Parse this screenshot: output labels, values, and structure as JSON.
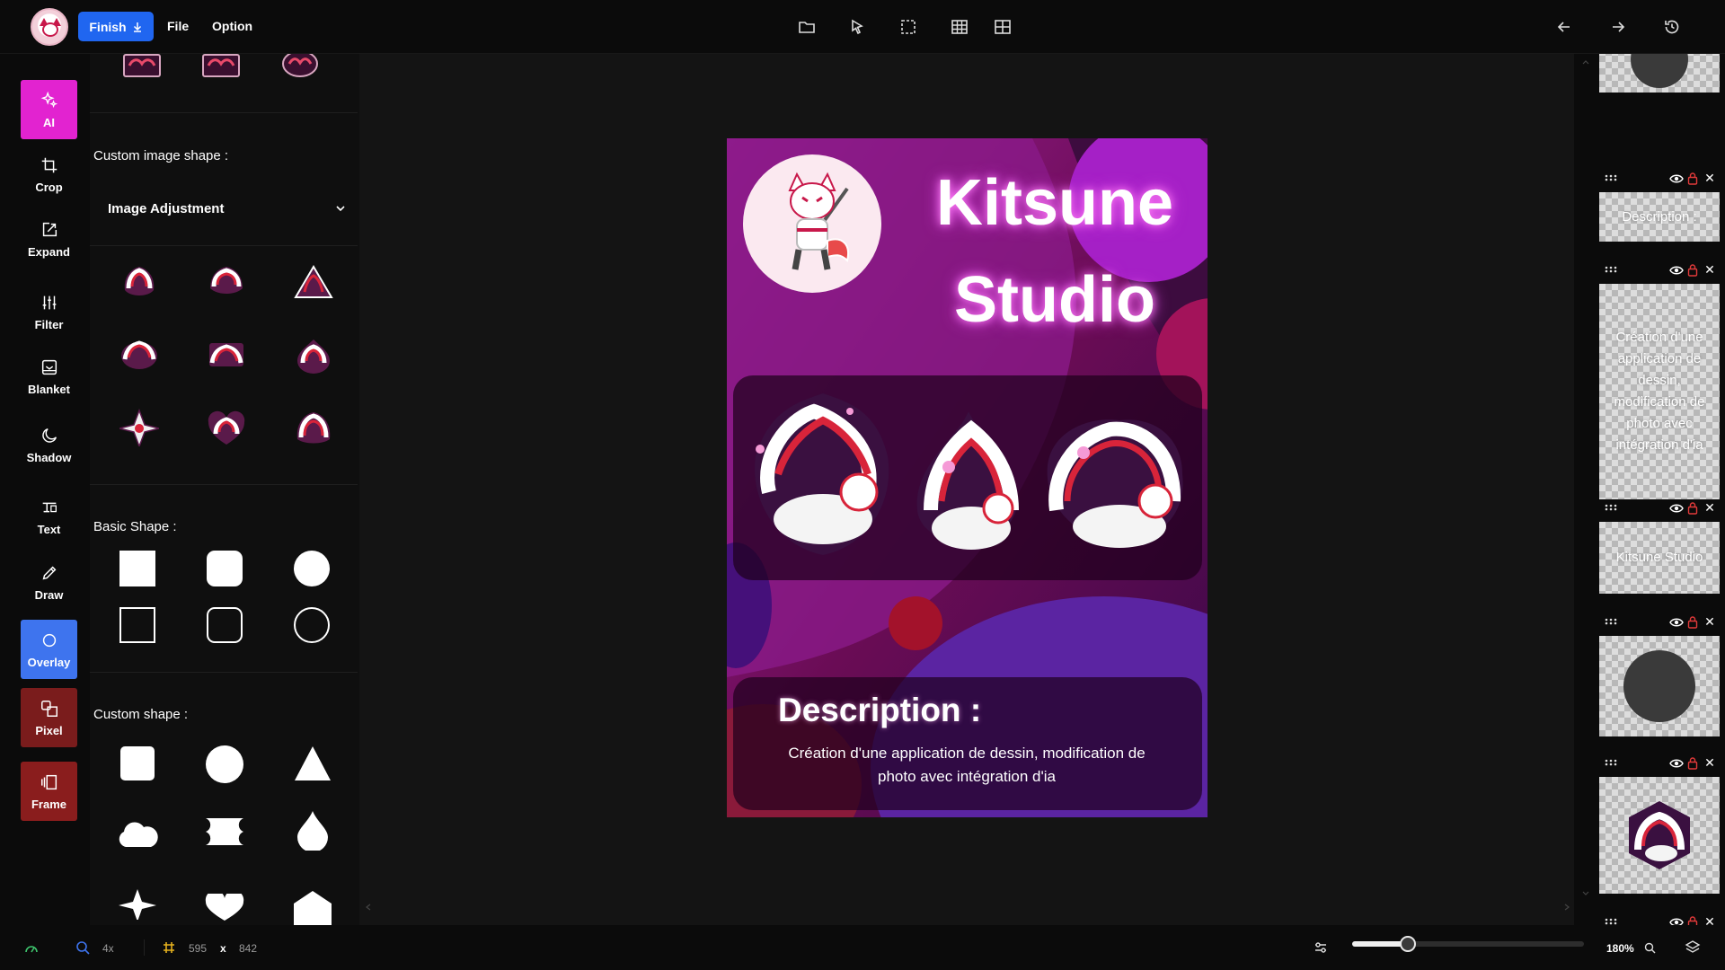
{
  "topbar": {
    "finish_label": "Finish",
    "menu": [
      "File",
      "Option"
    ],
    "icons": [
      "folder-icon",
      "select-cursor-icon",
      "marquee-select-icon",
      "grid-table-icon",
      "grid-layout-icon",
      "undo-arrow-icon",
      "redo-arrow-icon",
      "history-icon"
    ]
  },
  "toolbar": {
    "tools": [
      {
        "label": "AI",
        "icon": "ai-sparkle-icon"
      },
      {
        "label": "Crop",
        "icon": "crop-icon"
      },
      {
        "label": "Expand",
        "icon": "expand-icon"
      },
      {
        "label": "Filter",
        "icon": "sliders-icon"
      },
      {
        "label": "Blanket",
        "icon": "blanket-icon"
      },
      {
        "label": "Shadow",
        "icon": "moon-icon"
      },
      {
        "label": "Text",
        "icon": "text-icon"
      },
      {
        "label": "Draw",
        "icon": "pencil-icon"
      },
      {
        "label": "Overlay",
        "icon": "circle-icon"
      },
      {
        "label": "Pixel",
        "icon": "pixel-shapes-icon"
      },
      {
        "label": "Frame",
        "icon": "frame-icon"
      }
    ],
    "active": "Overlay"
  },
  "panel": {
    "custom_image_shape_title": "Custom image shape :",
    "image_adjustment_label": "Image Adjustment",
    "basic_shape_title": "Basic Shape :",
    "custom_shape_title": "Custom shape :"
  },
  "poster": {
    "title_line1": "Kitsune",
    "title_line2": "Studio",
    "description_heading": "Description :",
    "description_text": "Création d'une application de dessin, modification de photo avec intégration d'ia"
  },
  "layers": {
    "items": [
      {
        "label": ""
      },
      {
        "label": "Description :"
      },
      {
        "label": "Création d'une application de dessin, modification de photo avec intégration d'ia"
      },
      {
        "label": "Kitsune Studio"
      },
      {
        "label": ""
      },
      {
        "label": ""
      },
      {
        "label": ""
      }
    ]
  },
  "statusbar": {
    "zoom_factor": "4x",
    "width": "595",
    "times": "x",
    "height": "842",
    "zoom_percent": "180%",
    "zoom_slider_fraction": 0.24
  },
  "colors": {
    "finish_button": "#2066f0",
    "ai_tool": "#e223d0",
    "overlay_tool": "#3e74ee",
    "pixel_tool": "#7a1c1c"
  }
}
